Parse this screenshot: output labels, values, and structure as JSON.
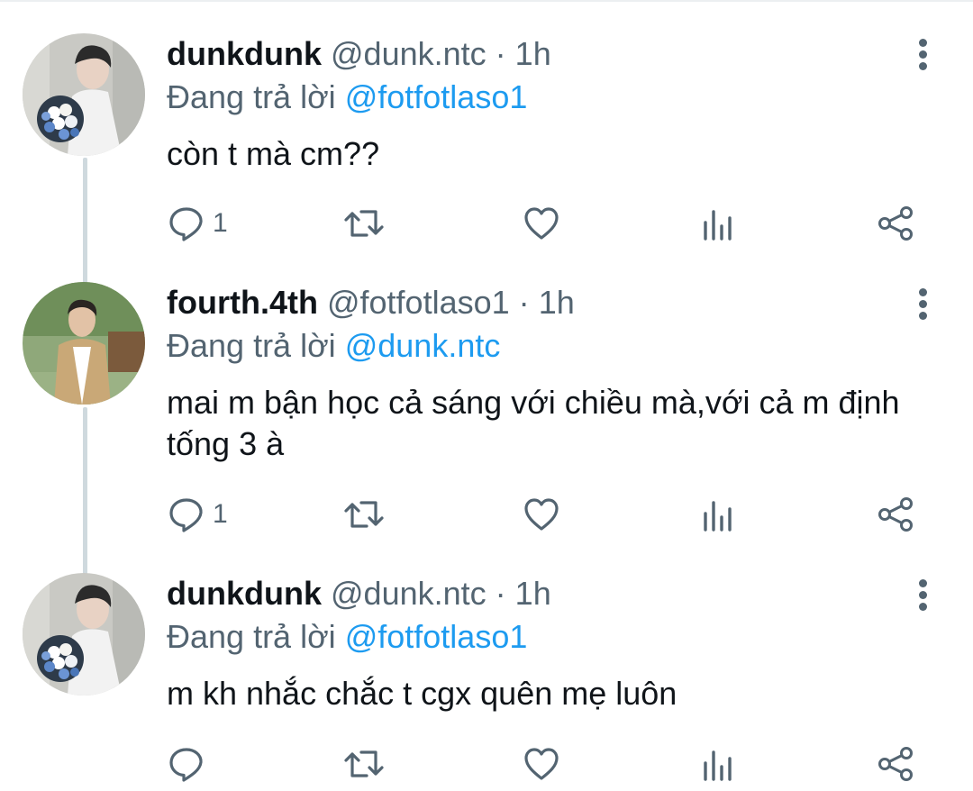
{
  "tweets": [
    {
      "name": "dunkdunk",
      "handle": "@dunk.ntc",
      "separator": "·",
      "time": "1h",
      "replying_prefix": "Đang trả lời",
      "replying_to": "@fotfotlaso1",
      "text": "còn t mà cm??",
      "reply_count": "1",
      "avatar": "avatar-dunkdunk"
    },
    {
      "name": "fourth.4th",
      "handle": "@fotfotlaso1",
      "separator": "·",
      "time": "1h",
      "replying_prefix": "Đang trả lời",
      "replying_to": "@dunk.ntc",
      "text": "mai m bận học cả sáng với chiều mà,với cả m định tống 3 à",
      "reply_count": "1",
      "avatar": "avatar-fourth"
    },
    {
      "name": "dunkdunk",
      "handle": "@dunk.ntc",
      "separator": "·",
      "time": "1h",
      "replying_prefix": "Đang trả lời",
      "replying_to": "@fotfotlaso1",
      "text": "m kh nhắc chắc t cgx quên mẹ luôn",
      "reply_count": "",
      "avatar": "avatar-dunkdunk"
    }
  ],
  "icons": {
    "reply": "reply-icon",
    "retweet": "retweet-icon",
    "like": "like-icon",
    "views": "views-icon",
    "share": "share-icon",
    "more": "more-icon"
  },
  "colors": {
    "mention": "#1d9bf0",
    "secondary_text": "#536471",
    "thread_line": "#cfd9de"
  }
}
